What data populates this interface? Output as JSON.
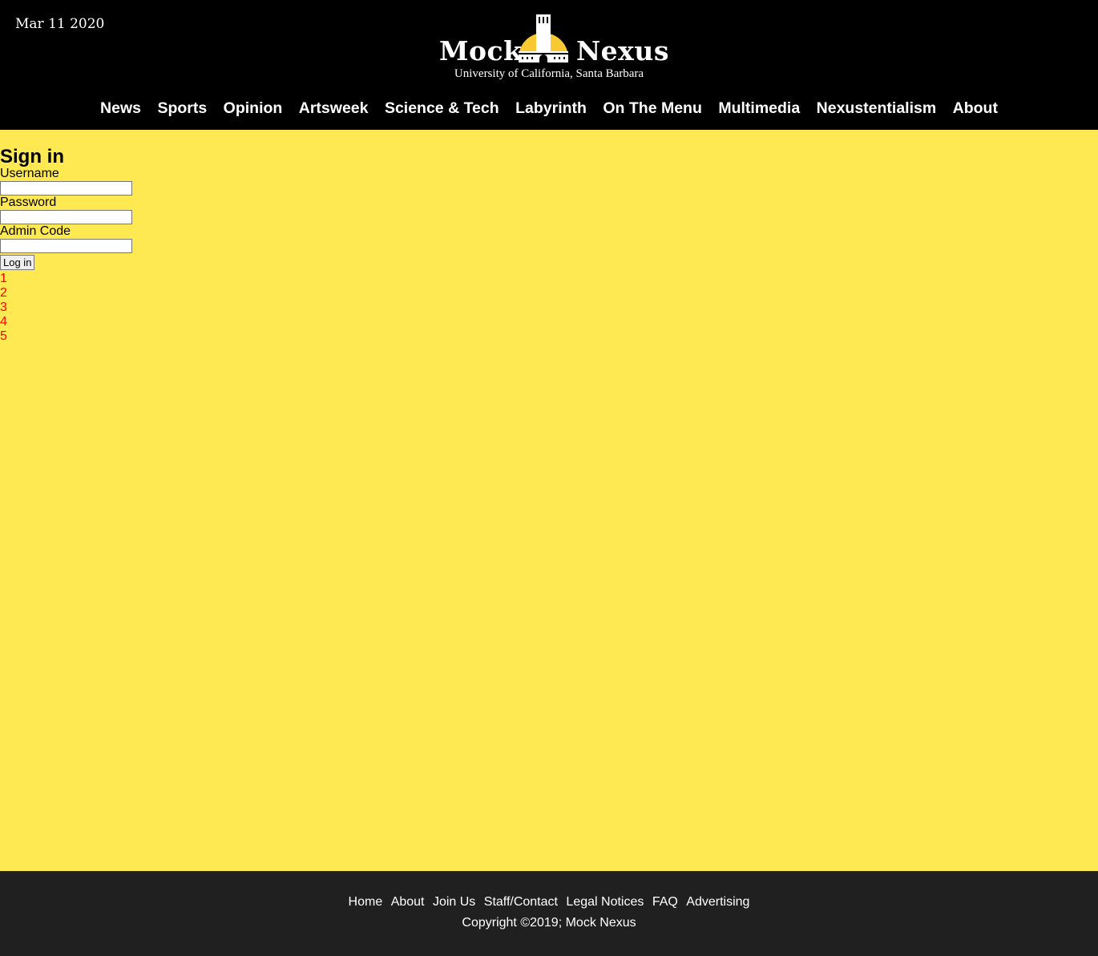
{
  "header": {
    "date": "Mar 11 2020",
    "logo": {
      "word_left": "Mock",
      "word_right": "Nexus",
      "subtitle": "University of California, Santa Barbara"
    },
    "nav": [
      {
        "label": "News"
      },
      {
        "label": "Sports"
      },
      {
        "label": "Opinion"
      },
      {
        "label": "Artsweek"
      },
      {
        "label": "Science & Tech"
      },
      {
        "label": "Labyrinth"
      },
      {
        "label": "On The Menu"
      },
      {
        "label": "Multimedia"
      },
      {
        "label": "Nexustentialism"
      },
      {
        "label": "About"
      }
    ]
  },
  "signin": {
    "title": "Sign in",
    "username_label": "Username",
    "username_value": "",
    "password_label": "Password",
    "password_value": "",
    "admin_code_label": "Admin Code",
    "admin_code_value": "",
    "login_button": "Log in"
  },
  "pager": [
    "1",
    "2",
    "3",
    "4",
    "5"
  ],
  "footer": {
    "links": [
      "Home",
      "About",
      "Join Us",
      "Staff/Contact",
      "Legal Notices",
      "FAQ",
      "Advertising"
    ],
    "copyright": "Copyright ©2019; Mock Nexus"
  },
  "colors": {
    "header_bg": "#000000",
    "page_bg": "#ffe953",
    "footer_bg": "#202020",
    "pager_link": "#ff0000",
    "emblem_gold": "#f9c934"
  },
  "icons": {
    "logo_emblem": "storke-tower-dome-icon"
  }
}
